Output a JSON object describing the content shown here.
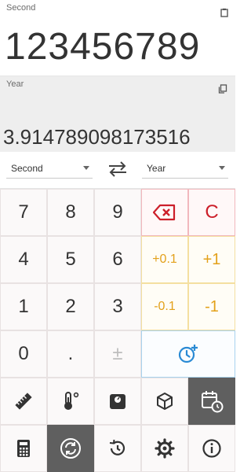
{
  "input": {
    "unit_label": "Second",
    "value": "123456789"
  },
  "output": {
    "unit_label": "Year",
    "value": "3.914789098173516"
  },
  "selectors": {
    "from": "Second",
    "to": "Year"
  },
  "keys": {
    "k7": "7",
    "k8": "8",
    "k9": "9",
    "clear": "C",
    "k4": "4",
    "k5": "5",
    "k6": "6",
    "plus01": "+0.1",
    "plus1": "+1",
    "k1": "1",
    "k2": "2",
    "k3": "3",
    "minus01": "-0.1",
    "minus1": "-1",
    "k0": "0",
    "dot": ".",
    "plusminus": "±"
  },
  "colors": {
    "accent_red": "#cc1f2a",
    "accent_yellow": "#e3a11b",
    "accent_blue": "#2a8ad4",
    "active_dark": "#5f5f5f"
  },
  "icons": {
    "backspace": "backspace-icon",
    "add_time": "add-time-icon",
    "length": "ruler-icon",
    "temperature": "thermometer-icon",
    "weight": "weight-icon",
    "volume": "cube-icon",
    "time": "calendar-clock-icon",
    "calculator": "calculator-icon",
    "converter": "convert-icon",
    "history": "history-icon",
    "settings": "gear-icon",
    "about": "info-icon"
  }
}
